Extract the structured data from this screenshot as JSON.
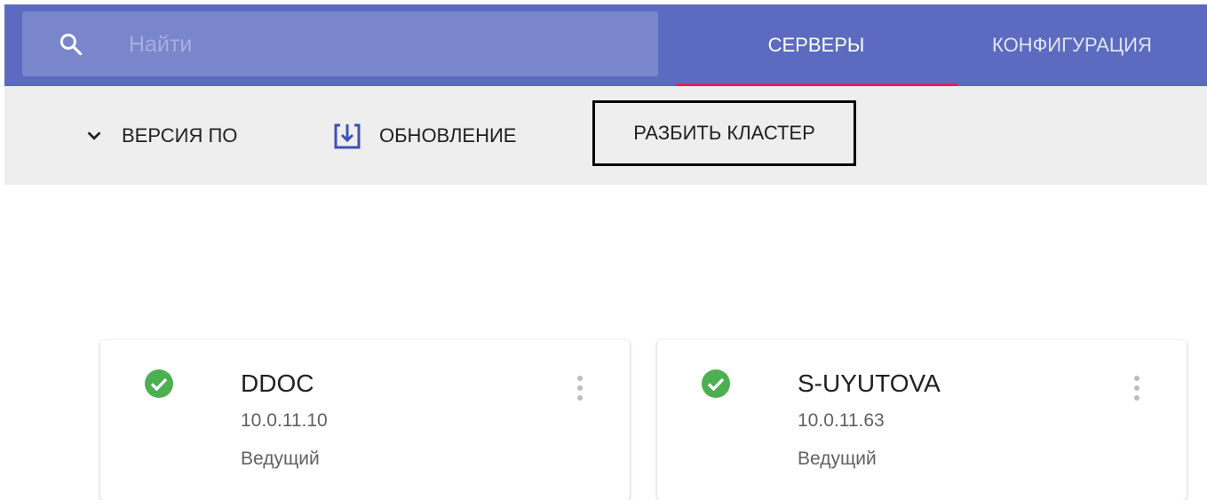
{
  "search": {
    "placeholder": "Найти",
    "icon": "search-icon"
  },
  "tabs": [
    {
      "label": "СЕРВЕРЫ",
      "active": true
    },
    {
      "label": "КОНФИГУРАЦИЯ",
      "active": false
    }
  ],
  "toolbar": {
    "version_label": "ВЕРСИЯ ПО",
    "update_label": "ОБНОВЛЕНИЕ",
    "split_label": "РАЗБИТЬ КЛАСТЕР"
  },
  "servers": [
    {
      "name": "DDOC",
      "ip": "10.0.11.10",
      "role": "Ведущий",
      "status": "ok"
    },
    {
      "name": "S-UYUTOVA",
      "ip": "10.0.11.63",
      "role": "Ведущий",
      "status": "ok"
    }
  ],
  "colors": {
    "header": "#5c6bc0",
    "search_box": "#7986cb",
    "active_tab_underline": "#e91e63",
    "status_ok": "#4caf50",
    "toolbar_bg": "#eeeeee"
  }
}
